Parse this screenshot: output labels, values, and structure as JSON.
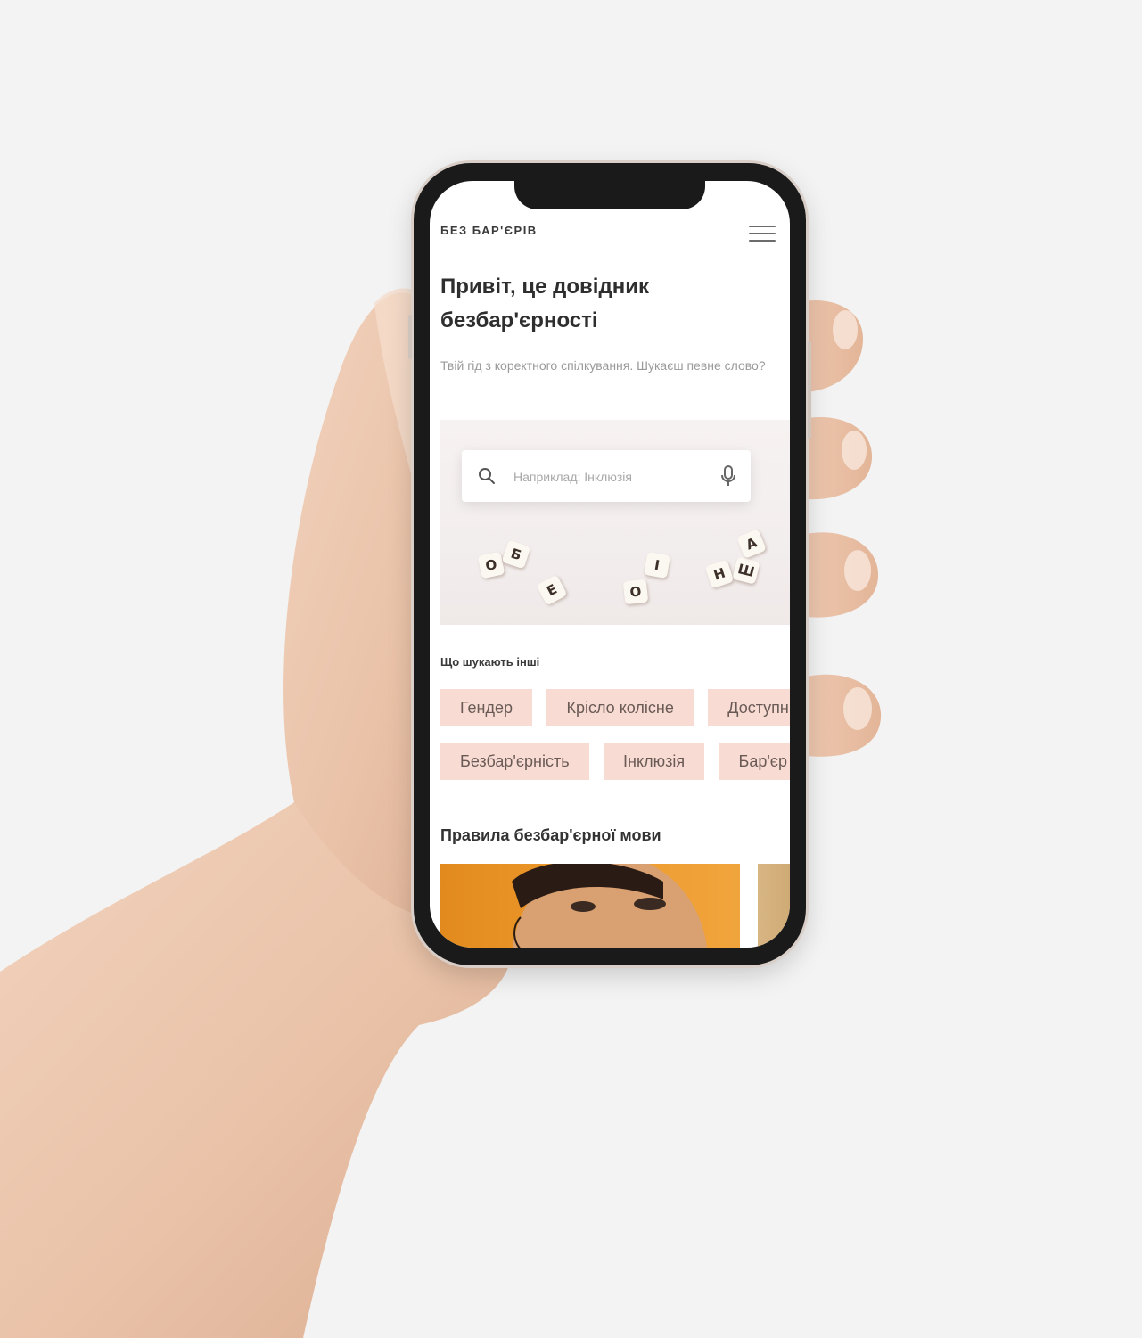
{
  "app": {
    "logo": "БЕЗ БАР'ЄРІВ"
  },
  "hero": {
    "title": "Привіт, це довідник безбар'єрності",
    "subtitle": "Твій гід з коректного спілкування. Шукаєш певне слово?"
  },
  "search": {
    "placeholder": "Наприклад: Інклюзія"
  },
  "tiles": [
    "О",
    "Б",
    "Е",
    "О",
    "І",
    "Н",
    "Ш",
    "А"
  ],
  "popular": {
    "label": "Що шукають інші",
    "row1": [
      "Гендер",
      "Крісло колісне",
      "Доступність"
    ],
    "row2": [
      "Безбар'єрність",
      "Інклюзія",
      "Бар'єр"
    ]
  },
  "rules": {
    "title": "Правила безбар'єрної мови"
  },
  "icons": {
    "menu": "hamburger-menu-icon",
    "search": "search-icon",
    "mic": "microphone-icon"
  },
  "colors": {
    "chip_bg": "#f8dcd3",
    "chip_text": "#6a5a55",
    "card_orange": "#ee9a2e"
  }
}
